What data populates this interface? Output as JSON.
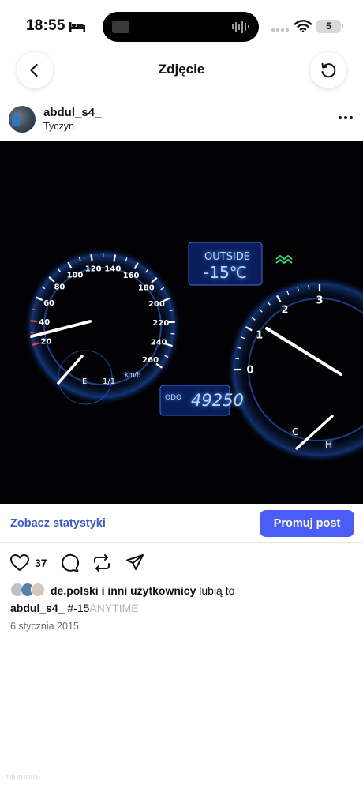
{
  "status_bar": {
    "time": "18:55",
    "battery": "5"
  },
  "header": {
    "title": "Zdjęcie"
  },
  "post": {
    "username": "abdul_s4_",
    "location": "Tyczyn"
  },
  "photo": {
    "outside_label": "OUTSIDE",
    "outside_temp": "-15℃",
    "odo_label": "ODO",
    "odometer": "49250",
    "speed_ticks": [
      "20",
      "40",
      "60",
      "80",
      "100",
      "120",
      "140",
      "160",
      "180",
      "200",
      "220",
      "240",
      "260"
    ],
    "speed_unit": "km/h",
    "fuel_labels": [
      "E",
      "1/1"
    ],
    "tacho_ticks": [
      "0",
      "1",
      "2",
      "3"
    ],
    "temp_labels": [
      "C",
      "H"
    ]
  },
  "insights": {
    "stats_link": "Zobacz statystyki",
    "promote_button": "Promuj post"
  },
  "actions": {
    "like_count": "37"
  },
  "likes": {
    "liked_by": "de.polski",
    "others": "i inni użytkownicy",
    "suffix": "lubią to"
  },
  "caption": {
    "username": "abdul_s4_",
    "text": "#-15",
    "faded": "ANYTIME"
  },
  "date": "6 stycznia 2015",
  "watermark": "otomoto",
  "colors": {
    "accent": "#4a5df9",
    "link": "#3b5bd6",
    "gauge_glow": "#3f8cff",
    "needle": "#ffffff"
  }
}
